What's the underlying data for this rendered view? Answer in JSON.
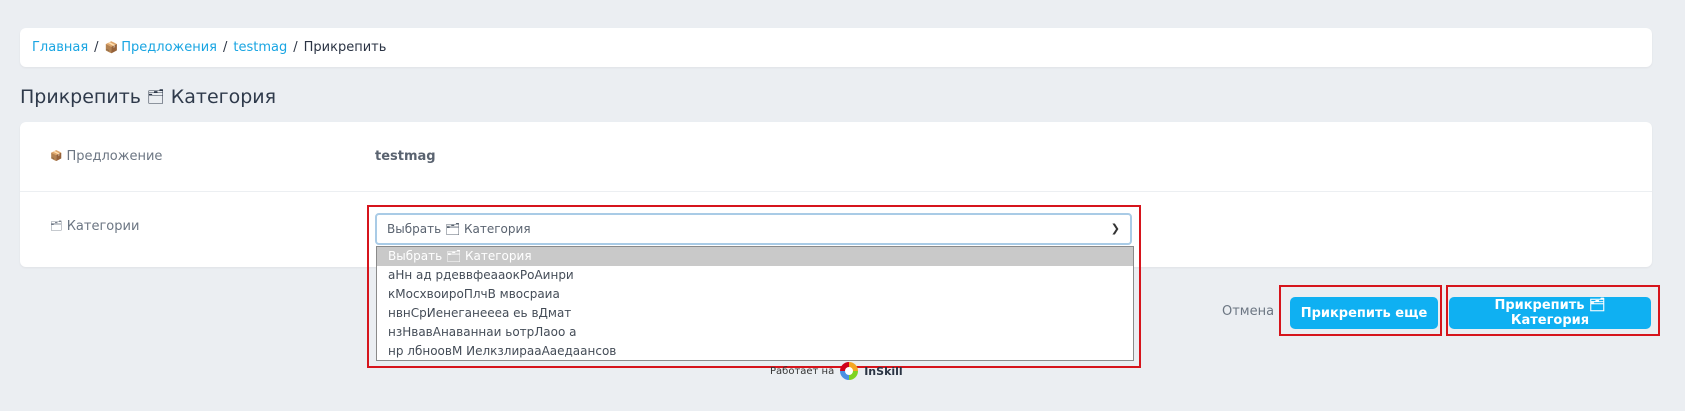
{
  "breadcrumb": {
    "home": "Главная",
    "offers_icon": "📦",
    "offers": "Предложения",
    "item": "testmag",
    "current": "Прикрепить",
    "separator": "/"
  },
  "page_title": {
    "text": "Прикрепить",
    "icon": "🗂",
    "suffix": "Категория"
  },
  "form": {
    "offer_label": "Предложение",
    "offer_icon": "📦",
    "offer_value": "testmag",
    "categories_label": "Категории",
    "categories_icon": "🗂"
  },
  "select": {
    "placeholder": "Выбрать 🗂 Категория",
    "options": [
      "Выбрать 🗂 Категория",
      "аНн ад рдеввфеааокРоАинри",
      "кМосхвоироПлчВ мвосраиа",
      "нвнСрИенеганеееа еь вДмат",
      "нзНвавАнаваннаи ьотрЛаоо а",
      "нр лбноовМ ИелкзлирааАаедаансов"
    ]
  },
  "footer": {
    "powered_by": "Работает на",
    "brand": "InSkill"
  },
  "actions": {
    "cancel": "Отмена",
    "attach_more": "Прикрепить еще",
    "attach_category": "Прикрепить 🗂 Категория"
  },
  "colors": {
    "accent": "#0fb0f2",
    "link": "#19a5e2",
    "highlight": "#d6141c"
  }
}
